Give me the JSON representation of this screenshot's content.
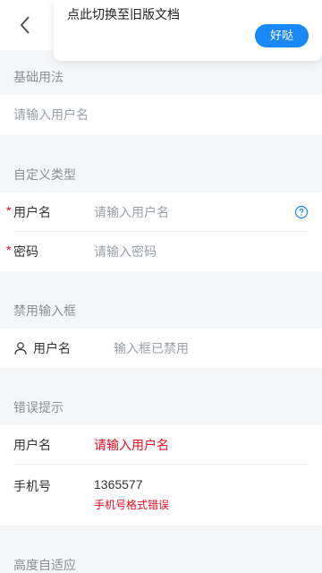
{
  "popover": {
    "text": "点此切换至旧版文档",
    "button": "好哒"
  },
  "sections": {
    "basic": {
      "title": "基础用法",
      "placeholder": "请输入用户名"
    },
    "custom": {
      "title": "自定义类型",
      "username_label": "用户名",
      "username_placeholder": "请输入用户名",
      "password_label": "密码",
      "password_placeholder": "请输入密码",
      "required_mark": "*"
    },
    "disabled": {
      "title": "禁用输入框",
      "label": "用户名",
      "value": "输入框已禁用"
    },
    "error": {
      "title": "错误提示",
      "username_label": "用户名",
      "username_placeholder": "请输入用户名",
      "phone_label": "手机号",
      "phone_value": "1365577",
      "phone_error": "手机号格式错误"
    },
    "autosize": {
      "title": "高度自适应"
    }
  },
  "colors": {
    "primary": "#1989fa",
    "danger": "#ee0a24",
    "muted": "#9aa0a6",
    "background": "#f5f6f7"
  },
  "icons": {
    "back": "chevron-left-icon",
    "help": "question-circle-icon",
    "user": "user-icon"
  }
}
